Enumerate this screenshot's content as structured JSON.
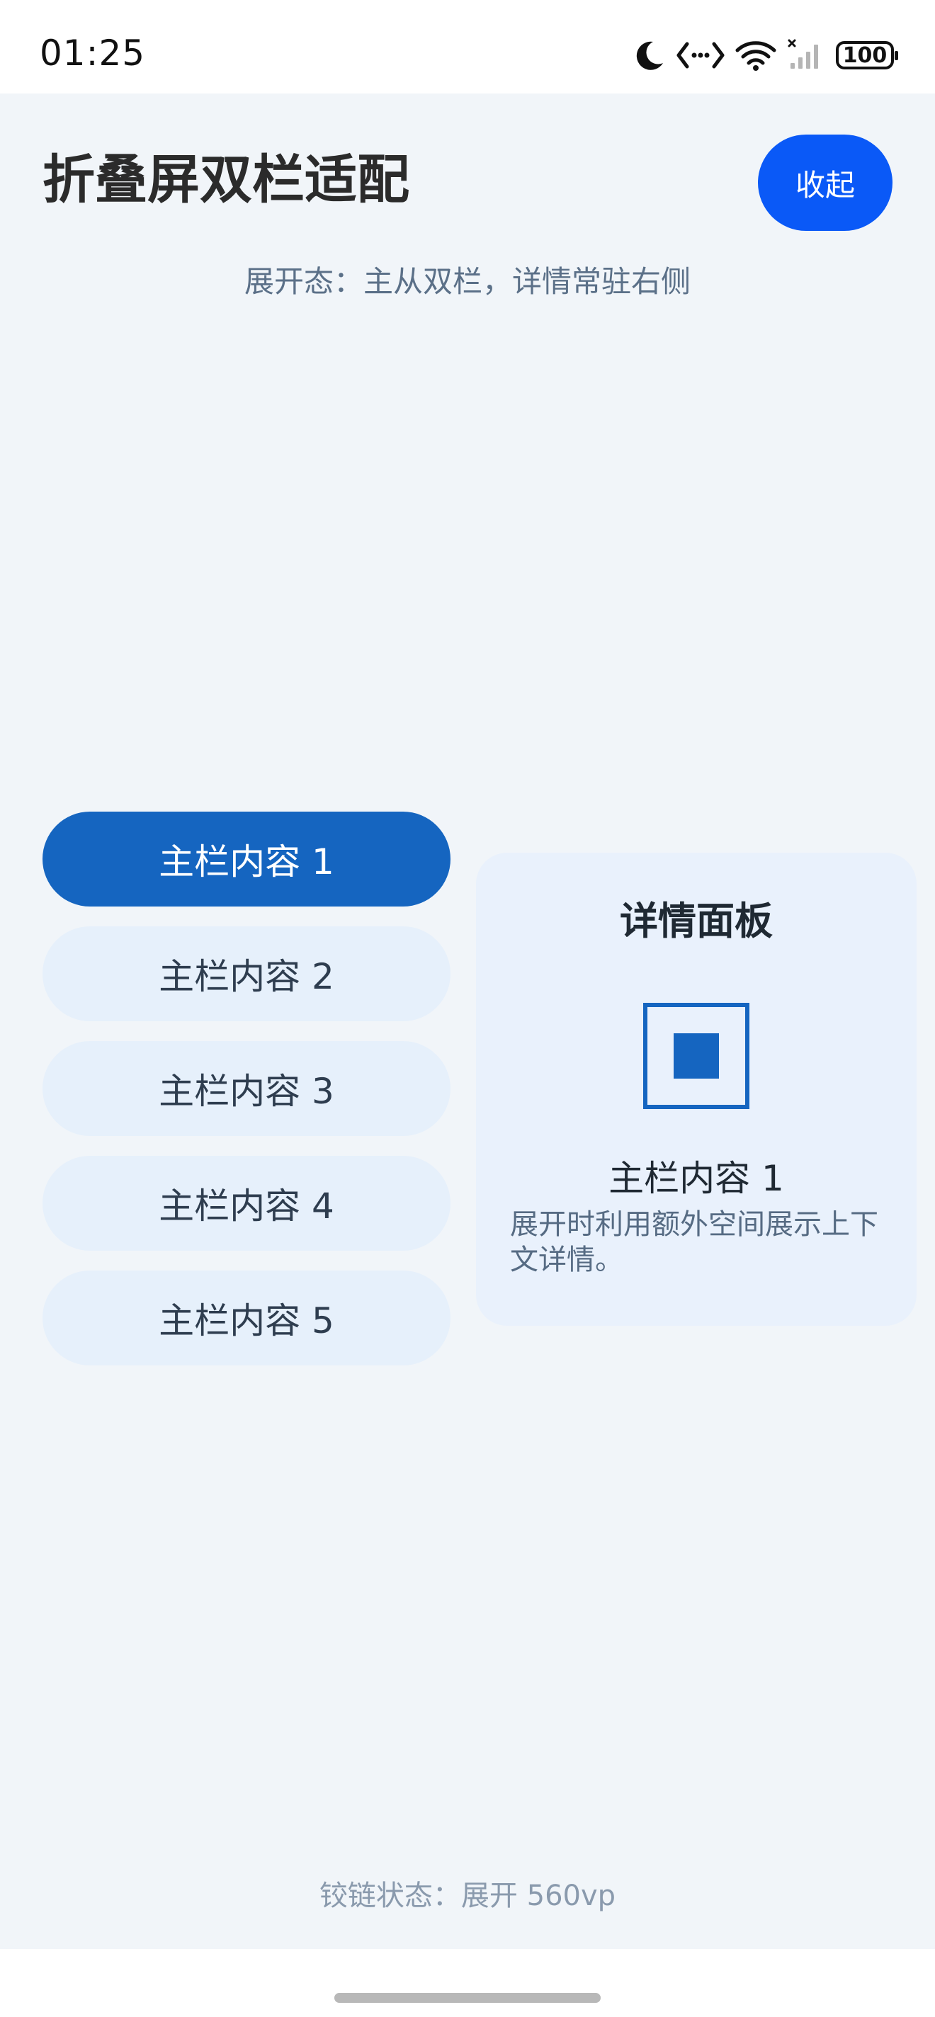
{
  "status_bar": {
    "time": "01:25",
    "battery": "100",
    "icons": [
      "moon-icon",
      "code-icon",
      "wifi-icon",
      "signal-icon",
      "battery-icon"
    ]
  },
  "header": {
    "title": "折叠屏双栏适配",
    "collapse_label": "收起",
    "subtitle": "展开态：主从双栏，详情常驻右侧"
  },
  "list": {
    "items": [
      {
        "label": "主栏内容 1",
        "selected": true
      },
      {
        "label": "主栏内容 2",
        "selected": false
      },
      {
        "label": "主栏内容 3",
        "selected": false
      },
      {
        "label": "主栏内容 4",
        "selected": false
      },
      {
        "label": "主栏内容 5",
        "selected": false
      }
    ]
  },
  "detail": {
    "title": "详情面板",
    "icon": "stop-square-icon",
    "item_label": "主栏内容 1",
    "description": "展开时利用额外空间展示上下文详情。"
  },
  "footer": {
    "hinge_status": "铰链状态：展开 560vp"
  },
  "colors": {
    "accent": "#0A59F7",
    "selected_item": "#1565C0",
    "item_bg": "#E6F0FB",
    "page_bg": "#F1F5F9",
    "panel_bg": "#E9F1FC"
  }
}
